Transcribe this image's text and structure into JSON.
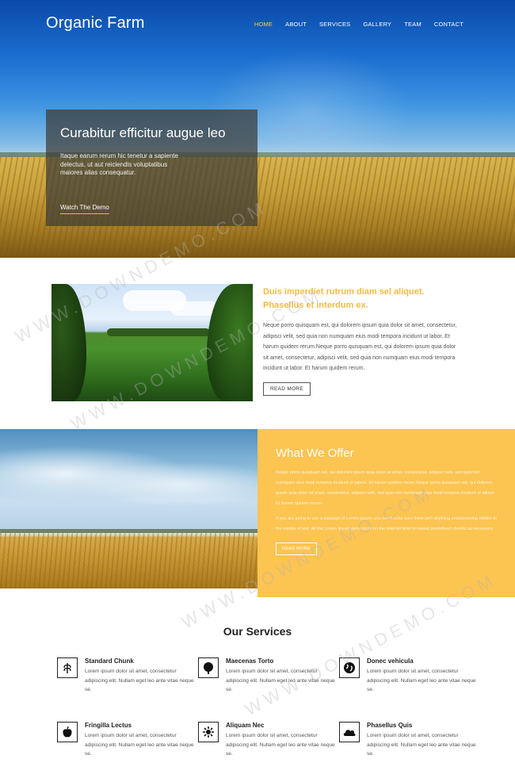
{
  "header": {
    "logo": "Organic Farm",
    "nav": [
      "HOME",
      "ABOUT",
      "SERVICES",
      "GALLERY",
      "TEAM",
      "CONTACT"
    ]
  },
  "hero": {
    "title": "Curabitur efficitur augue leo",
    "text": "Itaque earum rerum hic tenetur a sapiente delectus, ut aut reiciendis voluptatibus maiores alias consequatur.",
    "link": "Watch The Demo"
  },
  "about": {
    "heading": "Duis imperdiet rutrum diam sel aliquet. Phasellus et interdum ex.",
    "body": "Neque porro quisquam est, qui dolorem ipsum quia dolor sit amet, consectetur, adipisci velit, sed quia non numquam eius modi tempora incidunt ut labor. Et harum quidem rerum.Neque porro quisquam est, qui dolorem ipsum quia dolor sit amet, consectetur, adipisci velit, sed quia non numquam eius modi tempora incidunt ut labor. Et harum quidem rerum.",
    "button": "READ MORE"
  },
  "offer": {
    "title": "What We Offer",
    "para1": "Neque porro quisquam est, qui dolorem ipsum quia dolor sit amet, consectetur, adipisci velit, sed quia non numquam eius modi tempora incidunt ut labore. Et harum quidem rerum.Neque porro quisquam est, qui dolorem ipsum quia dolor sit amet, consectetur, adipisci velit, sed quia non numquam eius modi tempora incidunt ut labore. Et harum quidem rerum.",
    "para2": "If you are going to use a passage of Lorem Ipsum, you need to be sure there isn't anything embarrassing hidden in the middle of text. All the Lorem Ipsum generators on the Internet tend to repeat predefined chunks as necessary.",
    "button": "READ MORE"
  },
  "services": {
    "title": "Our Services",
    "items": [
      {
        "icon": "wheat-icon",
        "name": "Standard Chunk",
        "text": "Lorem ipsum dolor sit amet, consectetur adipiscing elit. Nullam eget leo ante vitae neque se."
      },
      {
        "icon": "tree-icon",
        "name": "Maecenas Torto",
        "text": "Lorem ipsum dolor sit amet, consectetur adipiscing elit. Nullam eget leo ante vitae neque se."
      },
      {
        "icon": "globe-icon",
        "name": "Donec vehicula",
        "text": "Lorem ipsum dolor sit amet, consectetur adipiscing elit. Nullam eget leo ante vitae neque se."
      },
      {
        "icon": "apple-icon",
        "name": "Fringilla Lectus",
        "text": "Lorem ipsum dolor sit amet, consectetur adipiscing elit. Nullam eget leo ante vitae neque se."
      },
      {
        "icon": "sun-icon",
        "name": "Aliquam Nec",
        "text": "Lorem ipsum dolor sit amet, consectetur adipiscing elit. Nullam eget leo ante vitae neque se."
      },
      {
        "icon": "cloud-icon",
        "name": "Phasellus Quis",
        "text": "Lorem ipsum dolor sit amet, consectetur adipiscing elit. Nullam eget leo ante vitae neque se."
      }
    ]
  },
  "watermark": "WWW.DOWNDEMO.COM",
  "colors": {
    "accent": "#fcc451",
    "heading_accent": "#f4bb44",
    "nav_active": "#ffcc4d"
  }
}
